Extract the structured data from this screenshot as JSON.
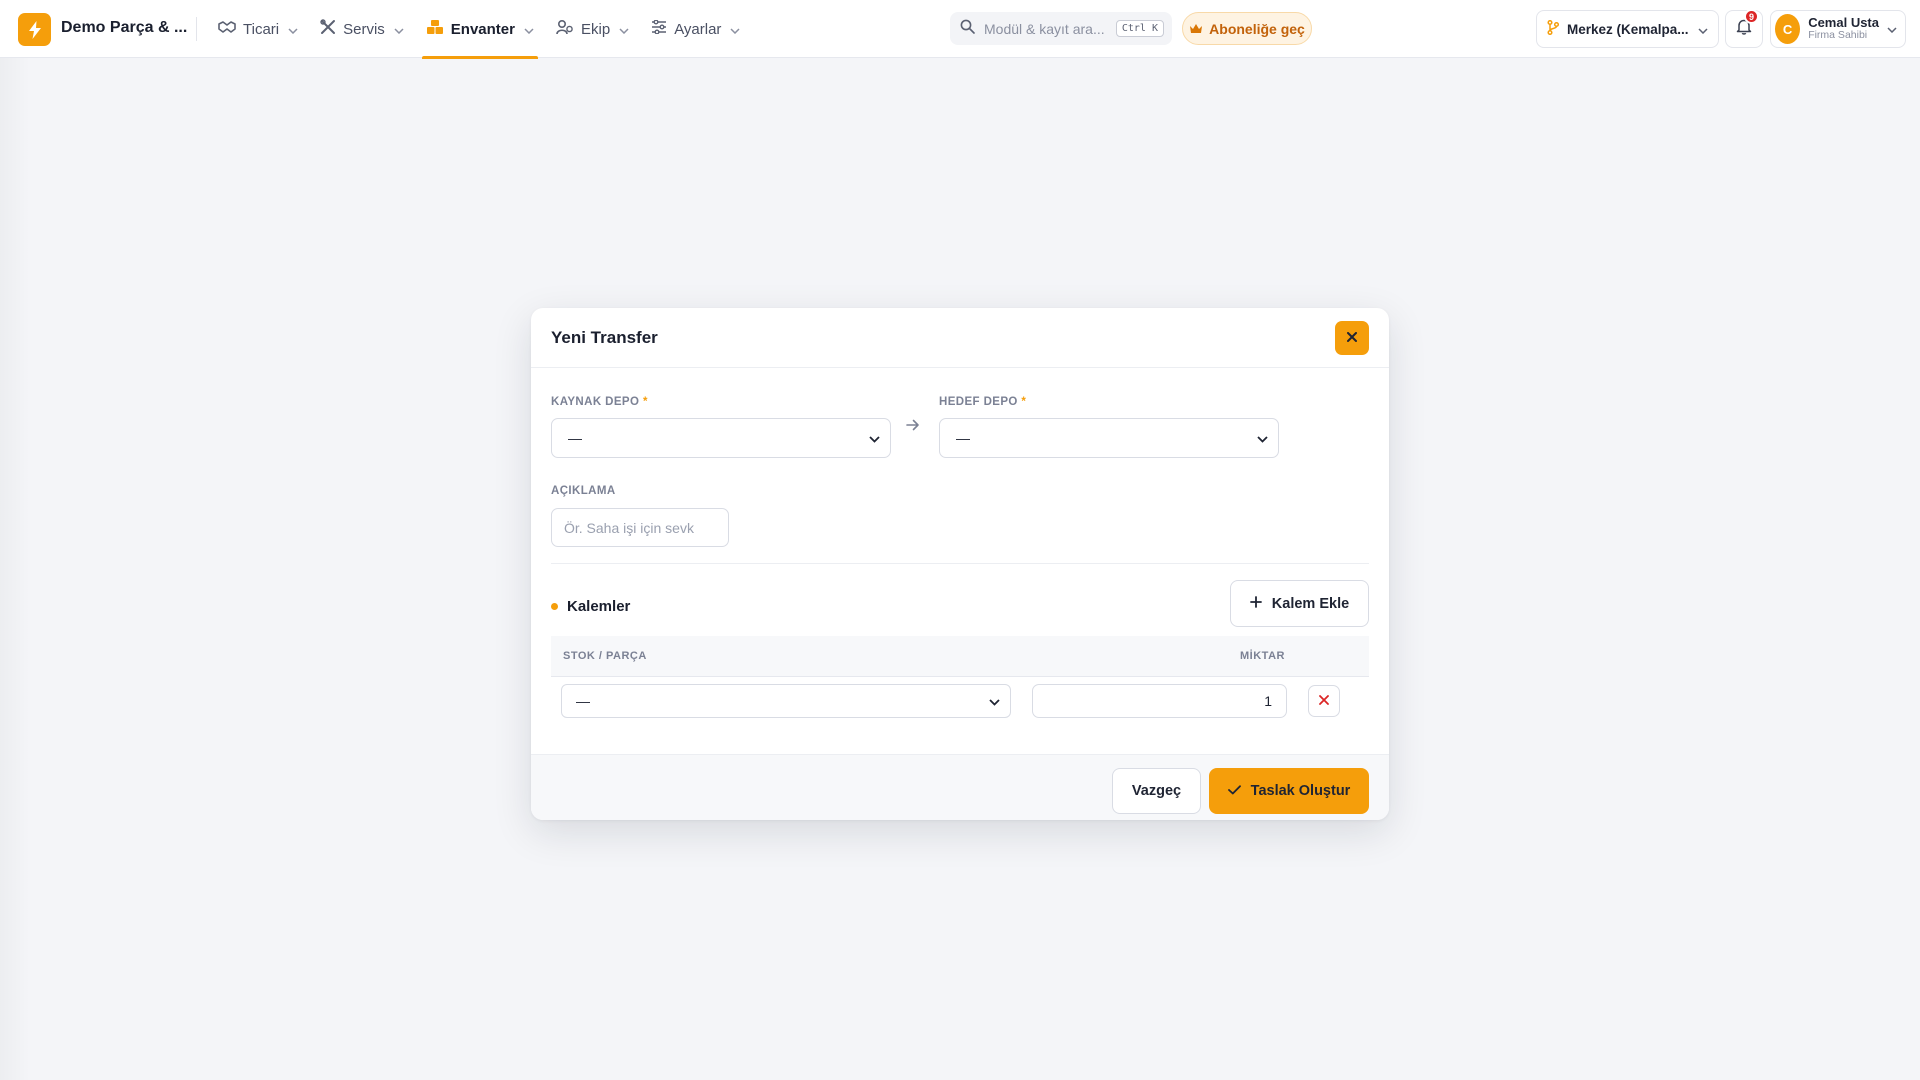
{
  "brand": {
    "name": "Demo Parça & ...",
    "logo_icon": "bolt-icon",
    "accent": "#f59e0b"
  },
  "nav": {
    "items": [
      {
        "label": "Ticari",
        "icon": "handshake-icon",
        "active": false
      },
      {
        "label": "Servis",
        "icon": "tools-icon",
        "active": false
      },
      {
        "label": "Envanter",
        "icon": "boxes-icon",
        "active": true
      },
      {
        "label": "Ekip",
        "icon": "users-icon",
        "active": false
      },
      {
        "label": "Ayarlar",
        "icon": "sliders-icon",
        "active": false
      }
    ]
  },
  "search": {
    "placeholder": "Modül & kayıt ara...",
    "shortcut": "Ctrl K"
  },
  "subscribe": {
    "label": "Aboneliğe geç",
    "icon": "crown-icon"
  },
  "branch": {
    "label": "Merkez (Kemalpa...",
    "icon": "git-branch-icon"
  },
  "notifications": {
    "count": "9"
  },
  "user": {
    "initial": "C",
    "name": "Cemal Usta",
    "role": "Firma Sahibi"
  },
  "modal": {
    "title": "Yeni Transfer",
    "source_label": "KAYNAK DEPO",
    "source_value": "—",
    "target_label": "HEDEF DEPO",
    "target_value": "—",
    "required_mark": "*",
    "description_label": "AÇIKLAMA",
    "description_placeholder": "Ör. Saha işi için sevk",
    "items_title": "Kalemler",
    "add_item_label": "Kalem Ekle",
    "table": {
      "col_stock": "STOK / PARÇA",
      "col_qty": "MİKTAR",
      "rows": [
        {
          "stock": "—",
          "qty": "1"
        }
      ]
    },
    "cancel_label": "Vazgeç",
    "submit_label": "Taslak Oluştur"
  }
}
